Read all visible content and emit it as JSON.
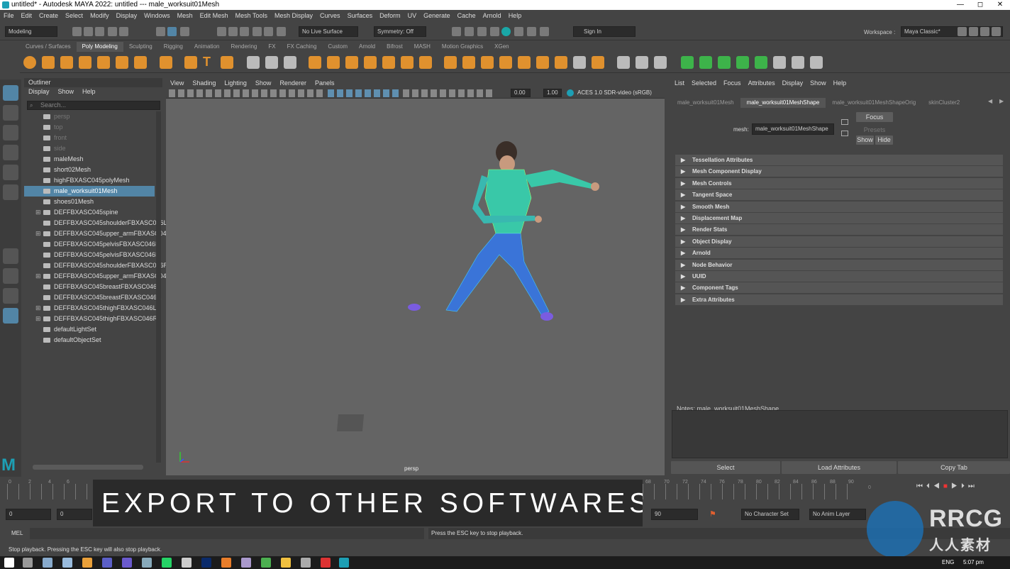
{
  "titlebar": {
    "title": "untitled* - Autodesk MAYA 2022: untitled   ---   male_worksuit01Mesh",
    "min": "—",
    "max": "◻",
    "close": "✕"
  },
  "menus": [
    "File",
    "Edit",
    "Create",
    "Select",
    "Modify",
    "Display",
    "Windows",
    "Mesh",
    "Edit Mesh",
    "Mesh Tools",
    "Mesh Display",
    "Curves",
    "Surfaces",
    "Deform",
    "UV",
    "Generate",
    "Cache",
    "Arnold",
    "Help"
  ],
  "workspace": {
    "label": "Workspace :",
    "value": "Maya Classic*"
  },
  "status": {
    "mode": "Modeling",
    "live_surface": "No Live Surface",
    "symmetry": "Symmetry: Off",
    "sign_in": "Sign In"
  },
  "shelf_tabs": [
    "Curves / Surfaces",
    "Poly Modeling",
    "Sculpting",
    "Rigging",
    "Animation",
    "Rendering",
    "FX",
    "FX Caching",
    "Custom",
    "Arnold",
    "Bifrost",
    "MASH",
    "Motion Graphics",
    "XGen"
  ],
  "shelf_active": "Poly Modeling",
  "outliner": {
    "title": "Outliner",
    "menu": [
      "Display",
      "Show",
      "Help"
    ],
    "search_placeholder": "Search...",
    "items": [
      {
        "label": "persp",
        "dim": true,
        "exp": ""
      },
      {
        "label": "top",
        "dim": true,
        "exp": ""
      },
      {
        "label": "front",
        "dim": true,
        "exp": ""
      },
      {
        "label": "side",
        "dim": true,
        "exp": ""
      },
      {
        "label": "maleMesh",
        "exp": ""
      },
      {
        "label": "short02Mesh",
        "exp": ""
      },
      {
        "label": "highFBXASC045polyMesh",
        "exp": ""
      },
      {
        "label": "male_worksuit01Mesh",
        "sel": true,
        "exp": ""
      },
      {
        "label": "shoes01Mesh",
        "exp": ""
      },
      {
        "label": "DEFFBXASC045spine",
        "exp": "⊞"
      },
      {
        "label": "DEFFBXASC045shoulderFBXASC046L",
        "exp": ""
      },
      {
        "label": "DEFFBXASC045upper_armFBXASC046l",
        "exp": "⊞"
      },
      {
        "label": "DEFFBXASC045pelvisFBXASC046L",
        "exp": ""
      },
      {
        "label": "DEFFBXASC045pelvisFBXASC046R",
        "exp": ""
      },
      {
        "label": "DEFFBXASC045shoulderFBXASC046R",
        "exp": ""
      },
      {
        "label": "DEFFBXASC045upper_armFBXASC046l",
        "exp": "⊞"
      },
      {
        "label": "DEFFBXASC045breastFBXASC046L",
        "exp": ""
      },
      {
        "label": "DEFFBXASC045breastFBXASC046R",
        "exp": ""
      },
      {
        "label": "DEFFBXASC045thighFBXASC046L",
        "exp": "⊞"
      },
      {
        "label": "DEFFBXASC045thighFBXASC046R",
        "exp": "⊞"
      },
      {
        "label": "defaultLightSet",
        "exp": ""
      },
      {
        "label": "defaultObjectSet",
        "exp": ""
      }
    ]
  },
  "viewport": {
    "menu": [
      "View",
      "Shading",
      "Lighting",
      "Show",
      "Renderer",
      "Panels"
    ],
    "val1": "0.00",
    "val2": "1.00",
    "colorspace": "ACES 1.0 SDR-video (sRGB)",
    "camera": "persp"
  },
  "ae": {
    "menu": [
      "List",
      "Selected",
      "Focus",
      "Attributes",
      "Display",
      "Show",
      "Help"
    ],
    "tabs": [
      "male_worksuit01Mesh",
      "male_worksuit01MeshShape",
      "male_worksuit01MeshShapeOrig",
      "skinCluster2"
    ],
    "active_tab": "male_worksuit01MeshShape",
    "mesh_label": "mesh:",
    "mesh_value": "male_worksuit01MeshShape",
    "focus": "Focus",
    "presets": "Presets",
    "show": "Show",
    "hide": "Hide",
    "sections": [
      "Tessellation Attributes",
      "Mesh Component Display",
      "Mesh Controls",
      "Tangent Space",
      "Smooth Mesh",
      "Displacement Map",
      "Render Stats",
      "Object Display",
      "Arnold",
      "Node Behavior",
      "UUID",
      "Component Tags",
      "Extra Attributes"
    ],
    "notes": "Notes:  male_worksuit01MeshShape",
    "buttons": [
      "Select",
      "Load Attributes",
      "Copy Tab"
    ]
  },
  "timeline": {
    "ticks_left": [
      "0",
      "2",
      "4",
      "6"
    ],
    "ticks_right": [
      "68",
      "70",
      "72",
      "74",
      "76",
      "78",
      "80",
      "82",
      "84",
      "86",
      "88",
      "90"
    ],
    "current": "0"
  },
  "range": {
    "start": "0",
    "start2": "0",
    "end": "90",
    "char_set": "No Character Set",
    "anim_layer": "No Anim Layer"
  },
  "banner": "EXPORT TO OTHER SOFTWARES",
  "mel": {
    "label": "MEL",
    "result": "Press the ESC key to stop playback."
  },
  "help_line": "Stop playback.  Pressing the ESC key will also stop playback.",
  "taskbar": {
    "lang": "ENG",
    "time": "5:07 pm"
  },
  "watermark": {
    "brand": "RRCG",
    "sub": "人人素材"
  }
}
